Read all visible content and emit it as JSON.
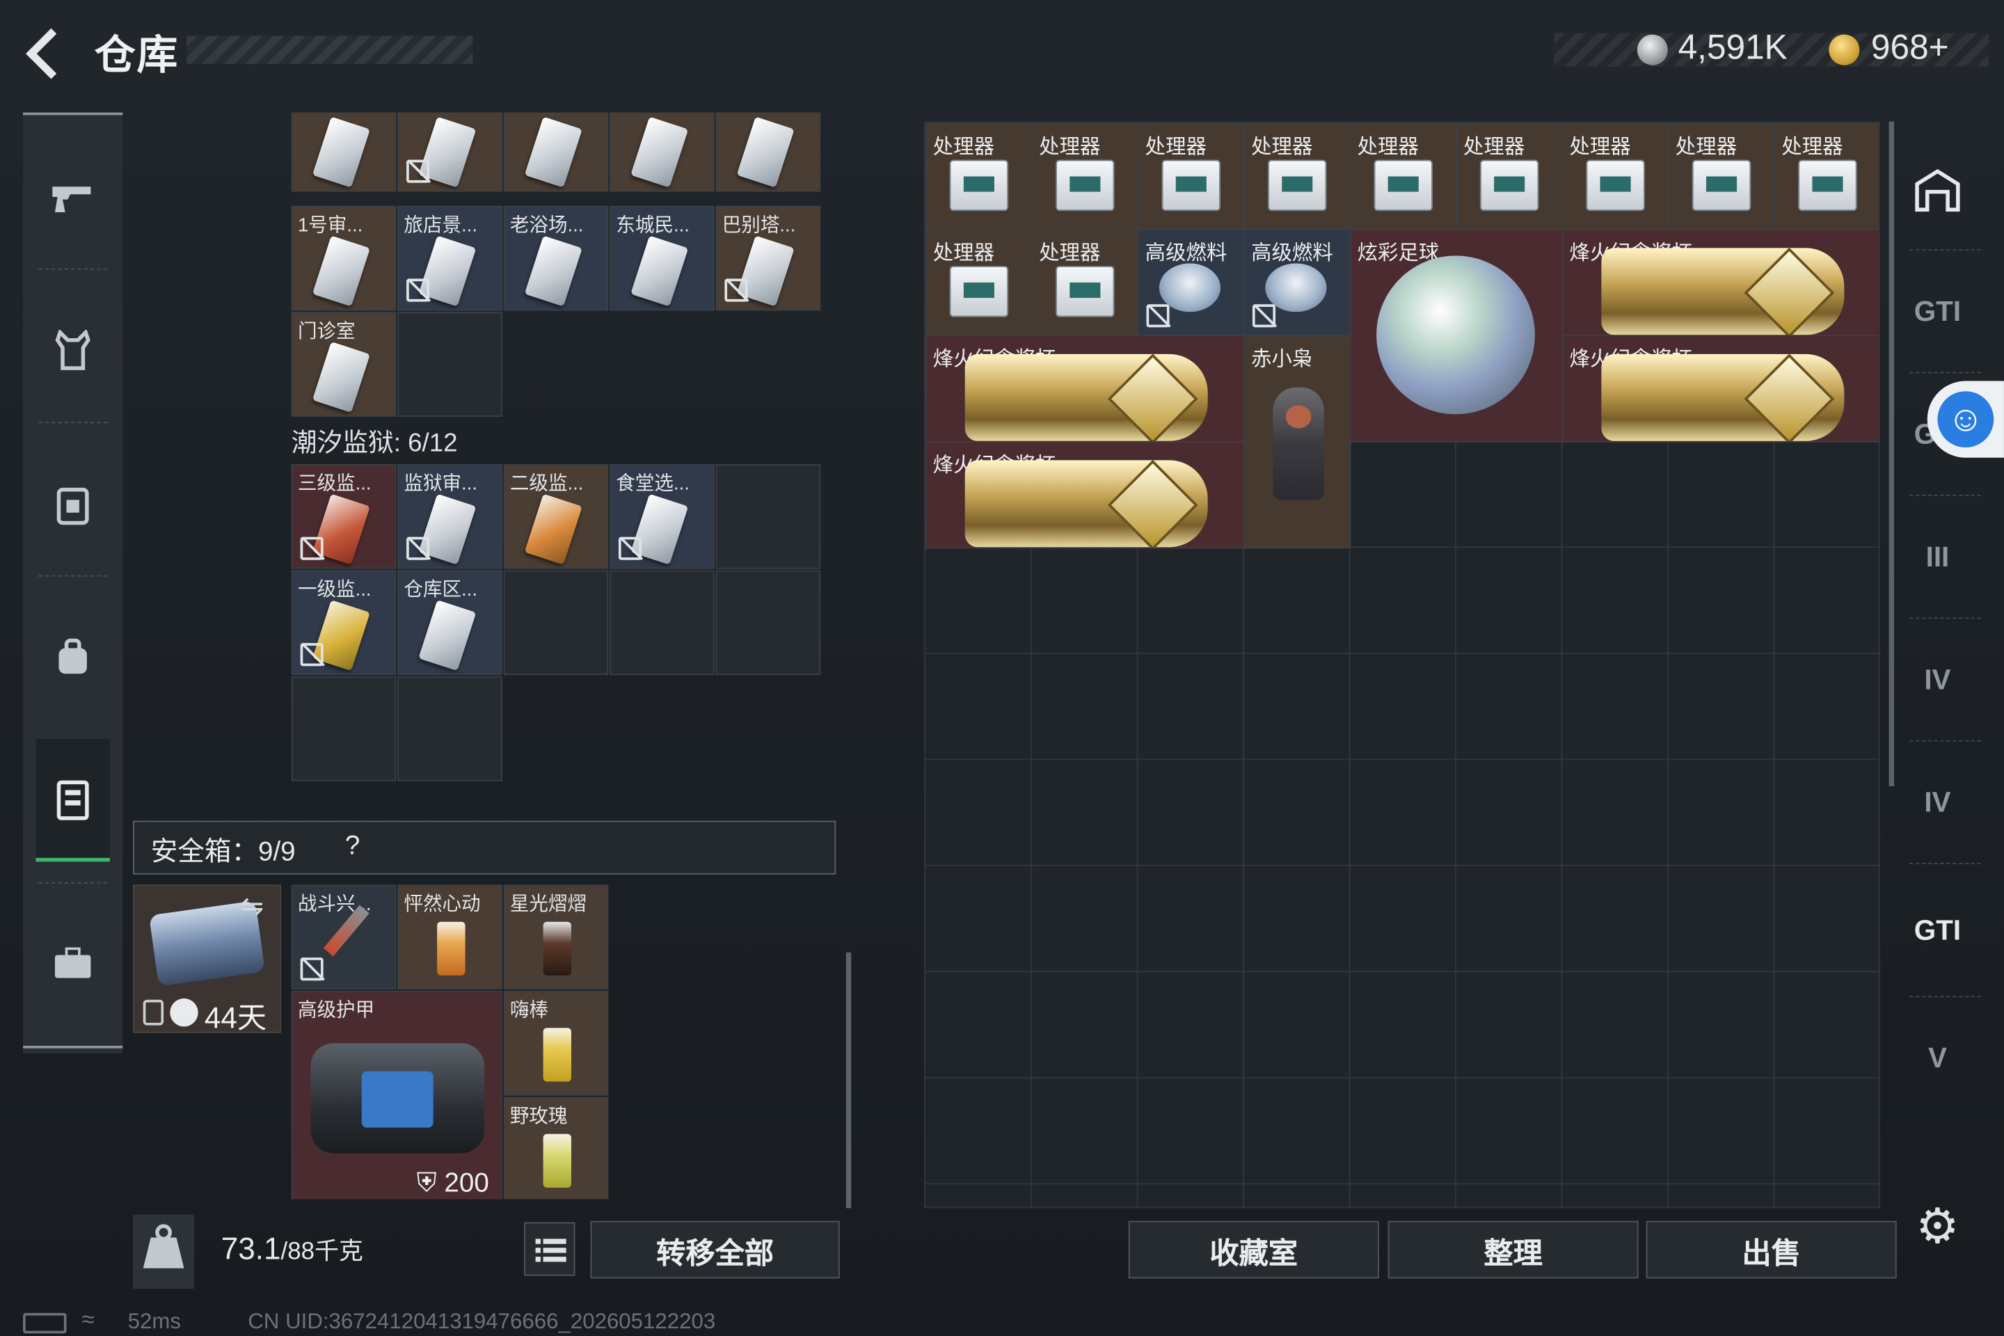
{
  "header": {
    "title": "仓库",
    "currency1": "4,591K",
    "currency2": "968+"
  },
  "left_nav": [
    "pistol-icon",
    "armor-vest-icon",
    "backpack-icon",
    "chest-rig-icon",
    "stash-icon",
    "briefcase-icon"
  ],
  "keys_top": [
    {
      "label": "",
      "nontrade": false
    },
    {
      "label": "",
      "nontrade": true
    },
    {
      "label": "",
      "nontrade": false
    },
    {
      "label": "",
      "nontrade": false
    },
    {
      "label": "",
      "nontrade": false
    },
    {
      "label": "1号审...",
      "nontrade": false
    },
    {
      "label": "旅店景...",
      "nontrade": true
    },
    {
      "label": "老浴场...",
      "nontrade": false
    },
    {
      "label": "东城民...",
      "nontrade": false
    },
    {
      "label": "巴别塔...",
      "nontrade": true
    },
    {
      "label": "门诊室",
      "nontrade": false
    }
  ],
  "prison": {
    "title": "潮汐监狱: 6/12",
    "items": [
      {
        "label": "三级监...",
        "nontrade": true,
        "color": "red"
      },
      {
        "label": "监狱审...",
        "nontrade": true,
        "color": "white"
      },
      {
        "label": "二级监...",
        "nontrade": false,
        "color": "orange"
      },
      {
        "label": "食堂选...",
        "nontrade": true,
        "color": "white"
      },
      {
        "label": "一级监...",
        "nontrade": true,
        "color": "yellow"
      },
      {
        "label": "仓库区...",
        "nontrade": false,
        "color": "white"
      }
    ]
  },
  "safe_box": {
    "label": "安全箱：9/9",
    "help": "?",
    "days": "44天",
    "items": [
      {
        "label": "战斗兴...",
        "nontrade": true
      },
      {
        "label": "怦然心动"
      },
      {
        "label": "星光熠熠"
      },
      {
        "label": "高级护甲",
        "durability": "200"
      },
      {
        "label": "嗨棒"
      },
      {
        "label": "野玫瑰"
      }
    ]
  },
  "bottom_left": {
    "weight_value": "73.1",
    "weight_max": "/88千克",
    "transfer_all": "转移全部"
  },
  "stash": {
    "processor_label": "处理器",
    "fuel_label": "高级燃料",
    "ball_label": "炫彩足球",
    "trophy_label": "烽火纪念奖杯",
    "figure_label": "赤小枭"
  },
  "bottom_right": {
    "collection": "收藏室",
    "sort": "整理",
    "sell": "出售"
  },
  "right_nav": [
    "GTI",
    "GTI",
    "III",
    "IV",
    "IV",
    "GTI",
    "V"
  ],
  "status": {
    "ping": "52ms",
    "uid": "CN UID:3672412041319476666_202605122203"
  }
}
